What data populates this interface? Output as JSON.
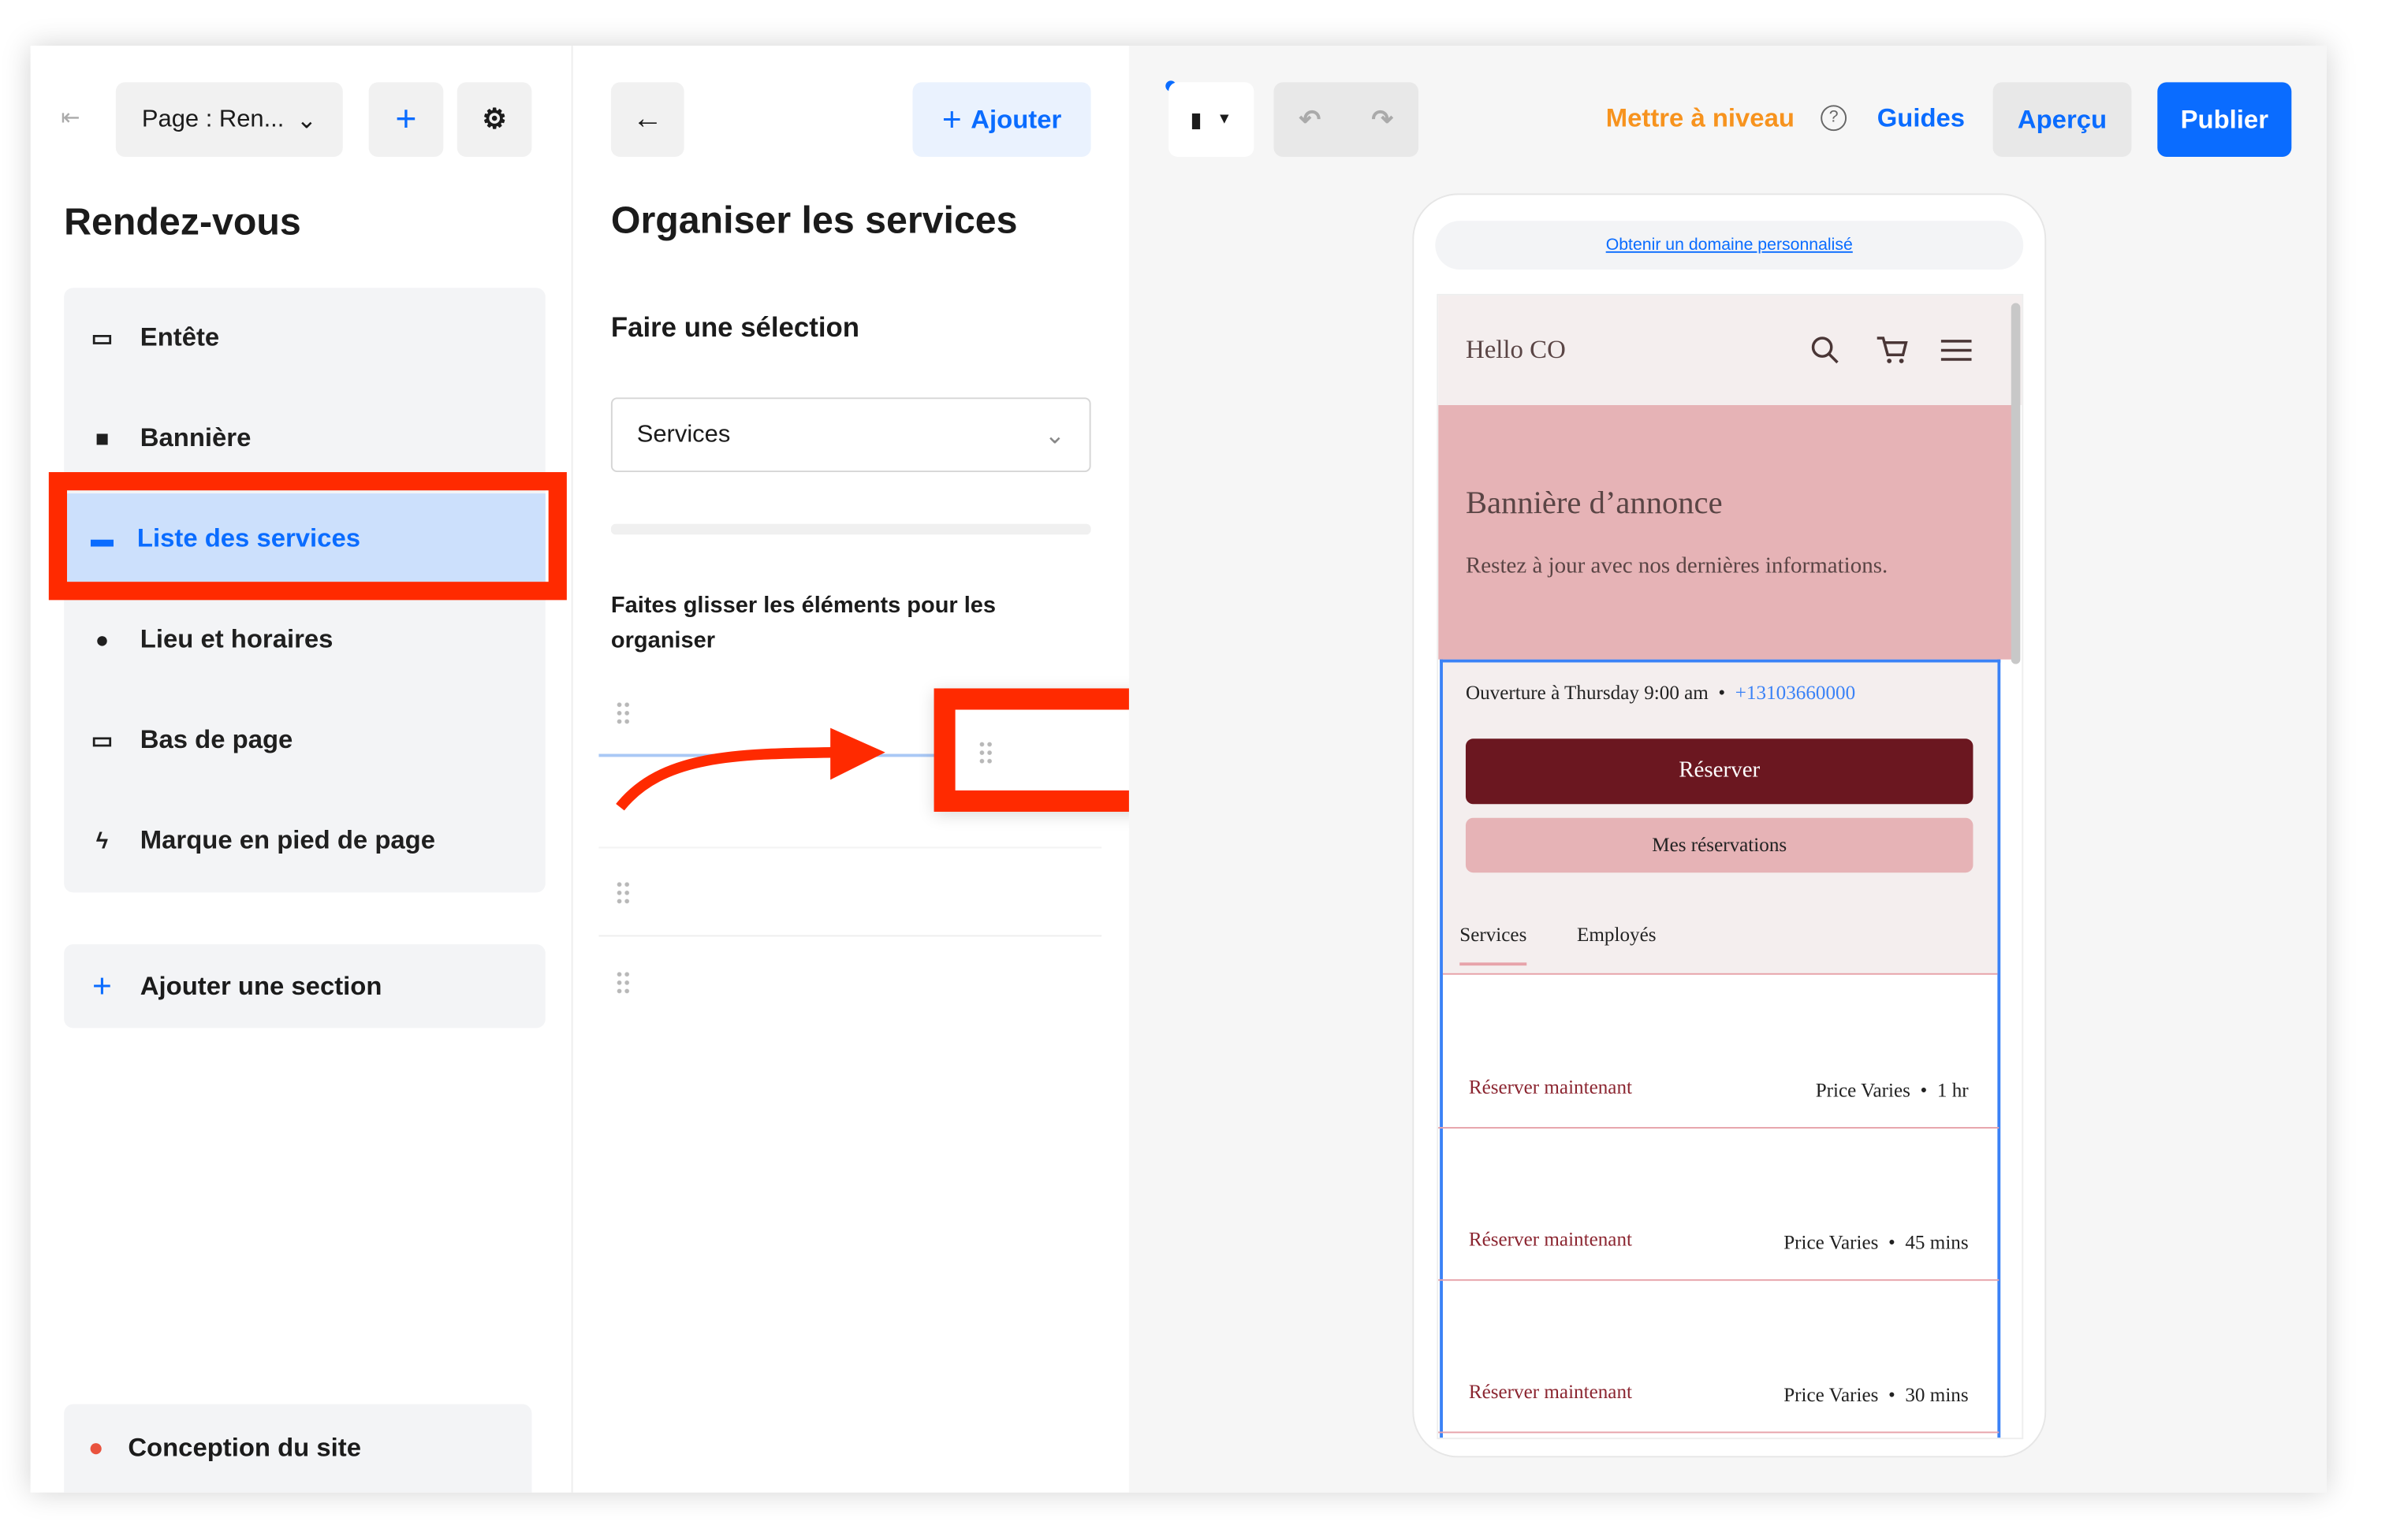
{
  "left_panel": {
    "page_select": "Page : Ren...",
    "title": "Rendez-vous",
    "sections": [
      {
        "label": "Entête",
        "icon": "header-icon"
      },
      {
        "label": "Bannière",
        "icon": "bookmark-icon"
      },
      {
        "label": "Liste des services",
        "icon": "calendar-icon",
        "selected": true
      },
      {
        "label": "Lieu et horaires",
        "icon": "location-pin-icon"
      },
      {
        "label": "Bas de page",
        "icon": "footer-icon"
      },
      {
        "label": "Marque en pied de page",
        "icon": "lightning-icon"
      }
    ],
    "add_section": "Ajouter une section",
    "site_design": "Conception du site"
  },
  "middle_panel": {
    "add_button": "Ajouter",
    "title": "Organiser les services",
    "select_label": "Faire une sélection",
    "select_value": "Services",
    "drag_hint": "Faites glisser les éléments pour les organiser"
  },
  "toolbar": {
    "upgrade": "Mettre à niveau",
    "guides": "Guides",
    "preview": "Aperçu",
    "publish": "Publier"
  },
  "colors": {
    "accent": "#0a6cff",
    "upgrade": "#f7931e",
    "annotation": "#ff2a00",
    "brand_dark": "#6b1720",
    "banner": "#e6b3b6"
  },
  "preview": {
    "domain_link": "Obtenir un domaine personnalisé",
    "site_name": "Hello CO",
    "banner_title": "Bannière d’annonce",
    "banner_text": "Restez à jour avec nos dernières informations.",
    "hours": "Ouverture à Thursday 9:00 am",
    "phone": "+13103660000",
    "book": "Réserver",
    "my_bookings": "Mes réservations",
    "tabs": [
      "Services",
      "Employés"
    ],
    "services": [
      {
        "action": "Réserver maintenant",
        "price": "Price Varies",
        "duration": "1 hr"
      },
      {
        "action": "Réserver maintenant",
        "price": "Price Varies",
        "duration": "45 mins"
      },
      {
        "action": "Réserver maintenant",
        "price": "Price Varies",
        "duration": "30 mins"
      }
    ]
  }
}
